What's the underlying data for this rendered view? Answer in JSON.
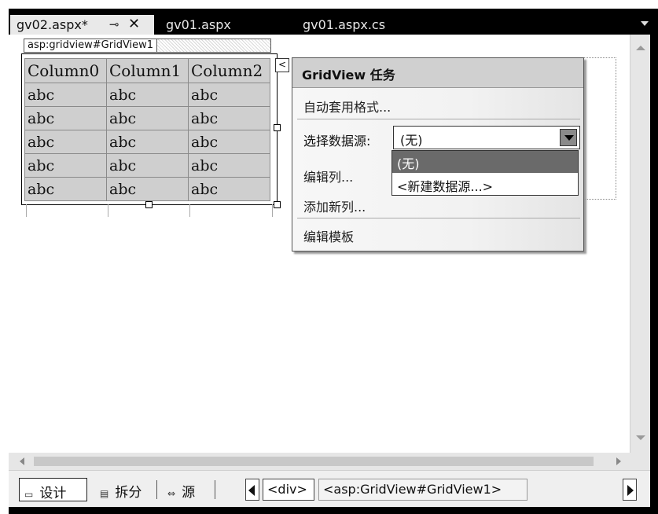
{
  "tabs": [
    {
      "label": "gv02.aspx*",
      "active": true,
      "pin": "⊸",
      "close": "✕"
    },
    {
      "label": "gv01.aspx"
    },
    {
      "label": "gv01.aspx.cs"
    }
  ],
  "gridview": {
    "tag_label": "asp:gridview#GridView1",
    "columns": [
      "Column0",
      "Column1",
      "Column2"
    ],
    "rows": [
      [
        "abc",
        "abc",
        "abc"
      ],
      [
        "abc",
        "abc",
        "abc"
      ],
      [
        "abc",
        "abc",
        "abc"
      ],
      [
        "abc",
        "abc",
        "abc"
      ],
      [
        "abc",
        "abc",
        "abc"
      ]
    ]
  },
  "smart_tag_glyph": "<",
  "tasks": {
    "title": "GridView 任务",
    "auto_format": "自动套用格式...",
    "choose_ds_label": "选择数据源:",
    "choose_ds_value": "(无)",
    "edit_columns": "编辑列...",
    "add_column": "添加新列...",
    "edit_templates": "编辑模板",
    "ds_options": [
      "(无)",
      "<新建数据源...>"
    ]
  },
  "view_buttons": {
    "design": "设计",
    "split": "拆分",
    "source": "源",
    "design_icon": "▭",
    "split_icon": "▤",
    "source_icon": "⇔"
  },
  "breadcrumb": [
    "<div>",
    "<asp:GridView#GridView1>"
  ]
}
